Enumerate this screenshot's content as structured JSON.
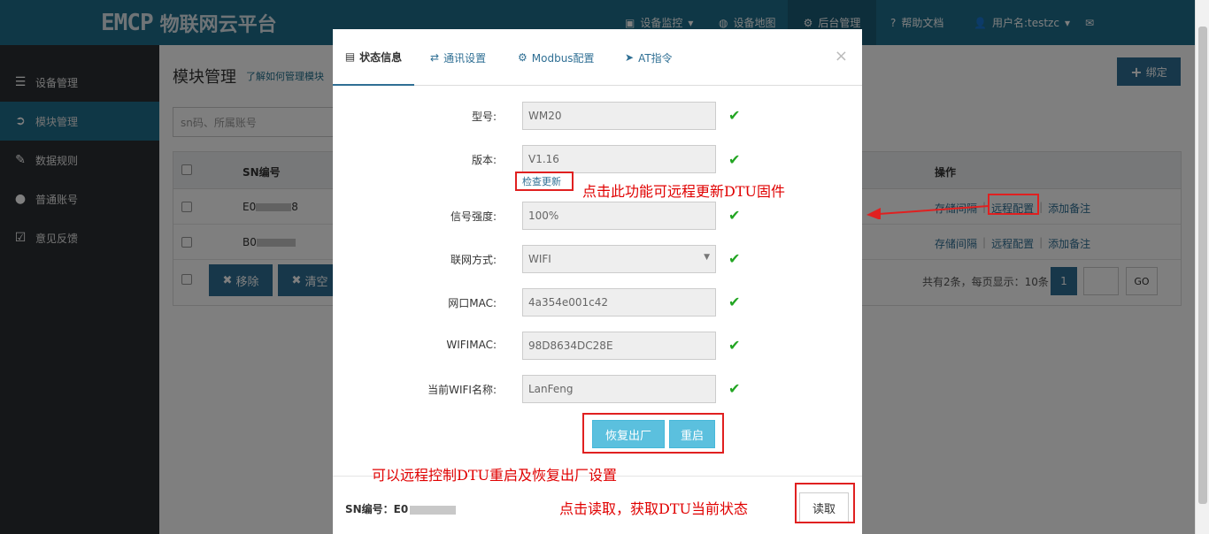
{
  "app": {
    "logo_mark": "EMCP",
    "logo_text": "物联网云平台"
  },
  "topnav": [
    {
      "icon": "monitor-icon",
      "label": "设备监控",
      "caret": "▾"
    },
    {
      "icon": "globe-icon",
      "label": "设备地图"
    },
    {
      "icon": "gears-icon",
      "label": "后台管理"
    },
    {
      "icon": "question-icon",
      "label": "帮助文档"
    },
    {
      "icon": "user-icon",
      "label": "用户名:testzc",
      "caret": "▾"
    },
    {
      "icon": "mail-icon",
      "label": ""
    }
  ],
  "sidebar": {
    "items": [
      {
        "icon": "list-icon",
        "label": "设备管理"
      },
      {
        "icon": "login-icon",
        "label": "模块管理"
      },
      {
        "icon": "pencil-icon",
        "label": "数据规则"
      },
      {
        "icon": "user-icon",
        "label": "普通账号"
      },
      {
        "icon": "edit-icon",
        "label": "意见反馈"
      }
    ]
  },
  "main": {
    "title": "模块管理",
    "help_link": "了解如何管理模块",
    "bind_button": "绑定",
    "search_placeholder": "sn码、所属账号",
    "table": {
      "col_sn": "SN编号",
      "col_ops": "操作",
      "rows": [
        {
          "sn_prefix": "E0",
          "sn_suffix": "8"
        },
        {
          "sn_prefix": "B0",
          "sn_suffix": ""
        }
      ],
      "ops": [
        "存储间隔",
        "远程配置",
        "添加备注"
      ]
    },
    "remove_button": "移除",
    "clear_button": "清空",
    "pager_text": "共有2条，每页显示：10条",
    "current_page": "1",
    "go_button": "GO"
  },
  "modal": {
    "tabs": [
      {
        "icon": "doc-icon",
        "label": "状态信息"
      },
      {
        "icon": "shuffle-icon",
        "label": "通讯设置"
      },
      {
        "icon": "gear-icon",
        "label": "Modbus配置"
      },
      {
        "icon": "send-icon",
        "label": "AT指令"
      }
    ],
    "close": "×",
    "fields": [
      {
        "label": "型号:",
        "value": "WM20"
      },
      {
        "label": "版本:",
        "value": "V1.16"
      },
      {
        "label": "信号强度:",
        "value": "100%"
      },
      {
        "label": "联网方式:",
        "value": "WIFI"
      },
      {
        "label": "网口MAC:",
        "value": "4a354e001c42"
      },
      {
        "label": "WIFIMAC:",
        "value": "98D8634DC28E"
      },
      {
        "label": "当前WIFI名称:",
        "value": "LanFeng"
      }
    ],
    "check_update": "检查更新",
    "factory_reset": "恢复出厂",
    "restart": "重启",
    "sn_label": "SN编号：E0",
    "read_button": "读取"
  },
  "annotations": {
    "update": "点击此功能可远程更新DTU固件",
    "control": "可以远程控制DTU重启及恢复出厂设置",
    "read": "点击读取，获取DTU当前状态"
  },
  "colors": {
    "brand": "#1f6e8d",
    "primary": "#2f6f94",
    "info": "#5bc0de",
    "annotation": "#e00000",
    "ok": "#22a522"
  }
}
